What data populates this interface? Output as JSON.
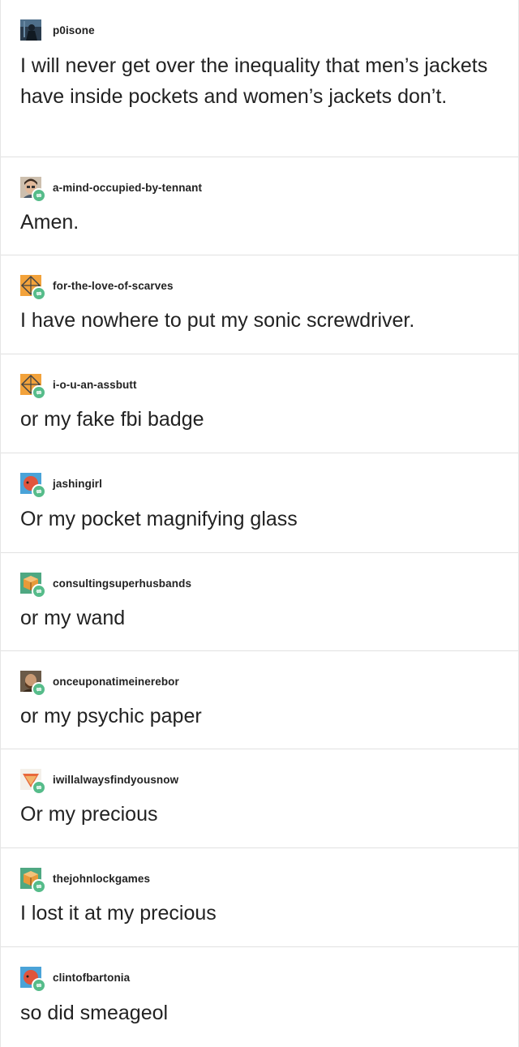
{
  "thread": {
    "posts": [
      {
        "username": "p0isone",
        "text": "I will never get over the inequality that men’s jackets have inside pockets and women’s jackets don’t.",
        "avatar": "dark-figure-avatar",
        "reblog": false
      },
      {
        "username": "a-mind-occupied-by-tennant",
        "text": "Amen.",
        "avatar": "person-photo-avatar",
        "reblog": true
      },
      {
        "username": "for-the-love-of-scarves",
        "text": "I have nowhere to put my sonic screwdriver.",
        "avatar": "orange-tardis-avatar",
        "reblog": true
      },
      {
        "username": "i-o-u-an-assbutt",
        "text": "or my fake fbi badge",
        "avatar": "orange-tardis-avatar",
        "reblog": true
      },
      {
        "username": "jashingirl",
        "text": "Or my pocket magnifying glass",
        "avatar": "blue-red-circle-avatar",
        "reblog": true
      },
      {
        "username": "consultingsuperhusbands",
        "text": "or my wand",
        "avatar": "green-cube-avatar",
        "reblog": true
      },
      {
        "username": "onceuponatimeinerebor",
        "text": "or my psychic paper",
        "avatar": "person-photo-avatar",
        "reblog": true
      },
      {
        "username": "iwillalwaysfindyousnow",
        "text": "Or my precious",
        "avatar": "orange-triangle-avatar",
        "reblog": true
      },
      {
        "username": "thejohnlockgames",
        "text": "I lost it at my precious",
        "avatar": "green-cube-avatar",
        "reblog": true
      },
      {
        "username": "clintofbartonia",
        "text": "so did smeageol",
        "avatar": "blue-red-circle-avatar",
        "reblog": true
      }
    ]
  },
  "colors": {
    "text": "#222222",
    "divider": "#e1e1e1",
    "reblog_badge": "#56bc8a"
  }
}
